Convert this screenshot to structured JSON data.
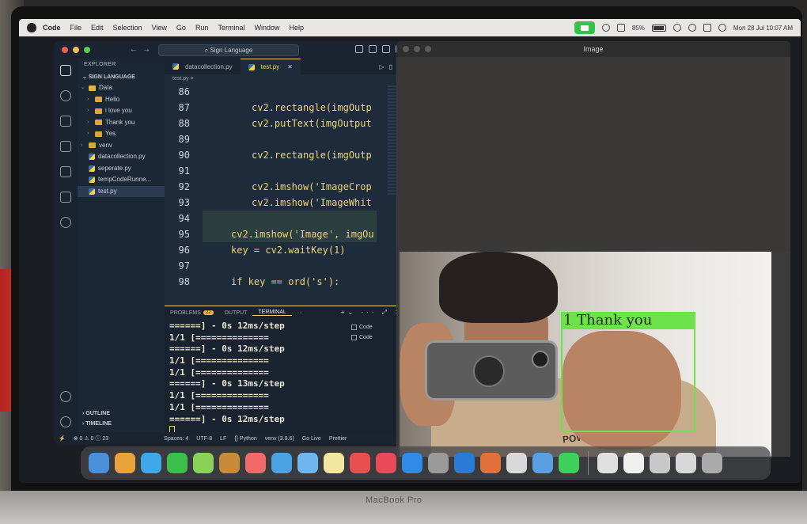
{
  "menubar": {
    "items": [
      "Code",
      "File",
      "Edit",
      "Selection",
      "View",
      "Go",
      "Run",
      "Terminal",
      "Window",
      "Help"
    ],
    "battery": "85%",
    "clock": "Mon 28 Jul  10:07 AM"
  },
  "vscode": {
    "search_label": "Sign Language",
    "explorer_title": "EXPLORER",
    "workspace": "SIGN LANGUAGE",
    "tree": [
      "Data",
      "Hello",
      "i love you",
      "Thank you",
      "Yes",
      "venv",
      "datacollection.py",
      "seperate.py",
      "tempCodeRunne...",
      "test.py"
    ],
    "outline": "OUTLINE",
    "timeline": "TIMELINE",
    "tabs": [
      "datacollection.py",
      "test.py"
    ],
    "breadcrumb": "test.py >",
    "code_lines": [
      {
        "n": "86",
        "t": ""
      },
      {
        "n": "87",
        "t": "cv2.rectangle(imgOutp"
      },
      {
        "n": "88",
        "t": "cv2.putText(imgOutput"
      },
      {
        "n": "89",
        "t": ""
      },
      {
        "n": "90",
        "t": "cv2.rectangle(imgOutp"
      },
      {
        "n": "91",
        "t": ""
      },
      {
        "n": "92",
        "t": "cv2.imshow('ImageCrop"
      },
      {
        "n": "93",
        "t": "cv2.imshow('ImageWhit"
      },
      {
        "n": "94",
        "t": ""
      },
      {
        "n": "95",
        "t": "cv2.imshow('Image', imgOu"
      },
      {
        "n": "96",
        "t": "key = cv2.waitKey(1)"
      },
      {
        "n": "97",
        "t": ""
      },
      {
        "n": "98",
        "t": "if key == ord('s'):"
      }
    ],
    "panel_tabs": [
      "PROBLEMS",
      "OUTPUT",
      "TERMINAL",
      "···"
    ],
    "problems_count": "22",
    "terminal_lines": [
      "======] - 0s 12ms/step",
      "1/1 [==============",
      "======] - 0s 12ms/step",
      "1/1 [==============",
      "1/1 [==============",
      "======] - 0s 13ms/step",
      "1/1 [==============",
      "1/1 [==============",
      "======] - 0s 12ms/step"
    ],
    "terminal_sessions": [
      "Code",
      "Code"
    ],
    "status": {
      "errors": "⊗ 0 ⚠ 0 ⓘ 23",
      "spaces": "Spaces: 4",
      "encoding": "UTF-8",
      "eol": "LF",
      "language": "{} Python",
      "env": "venv (3.9.6)",
      "golive": "Go Live",
      "prettier": "Prettier"
    }
  },
  "image_window": {
    "title": "Image",
    "prediction_label": "1 Thank you",
    "shirt_text": "POWER"
  },
  "dock": {
    "colors": [
      "#4a90d9",
      "#e8a23a",
      "#3fa6e8",
      "#3cbf4a",
      "#8ad15a",
      "#c98a3a",
      "#f06a6a",
      "#4aa3e0",
      "#6fb6ef",
      "#f3e6a0",
      "#e85050",
      "#e84a5a",
      "#2f8ae8",
      "#9a9a9a",
      "#2a7ad8",
      "#e2703a",
      "#d9d9d9",
      "#5aa0e0",
      "#3fcf5a",
      "#e0e0e0",
      "#f0f0f0",
      "#c8c8c8",
      "#d8d8d8",
      "#aaaaaa"
    ]
  }
}
